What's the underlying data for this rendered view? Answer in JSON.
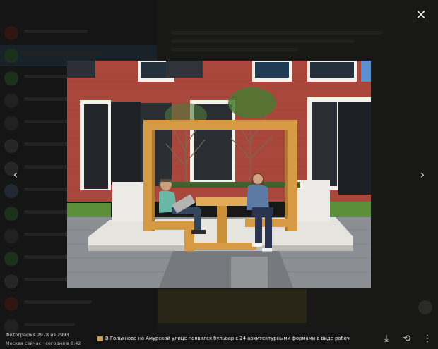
{
  "viewer": {
    "counter": "Фотография 2978 из 2993",
    "meta": "Москва сейчас · сегодня в 8:42",
    "caption": "В Гольяново на Амурской улице появился бульвар с 24 архитектурными формами в виде рабочих кабинетов",
    "icons": {
      "close": "✕",
      "prev": "‹",
      "next": "›",
      "download": "⤓",
      "share": "⟲",
      "more": "⋮"
    }
  },
  "colors": {
    "brick": "#a9473c",
    "wood": "#d59a43",
    "pavement": "#8b8e92",
    "sky": "#7aa7d6",
    "concrete": "#e6e4df"
  }
}
